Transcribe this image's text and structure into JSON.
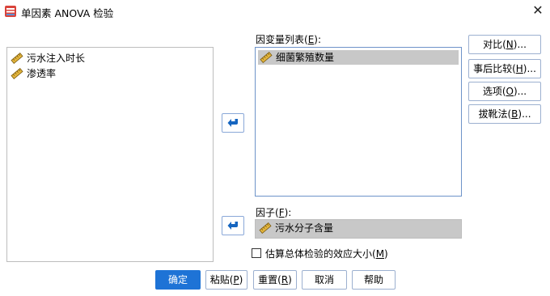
{
  "window": {
    "title": "单因素 ANOVA 检验",
    "close_symbol": "✕"
  },
  "source_list": {
    "items": [
      {
        "label": "污水注入时长",
        "icon": "scale-ruler-icon"
      },
      {
        "label": "渗透率",
        "icon": "scale-ruler-icon"
      }
    ]
  },
  "dependent": {
    "label_prefix": "因变量列表(",
    "label_key": "E",
    "label_suffix": "):",
    "items": [
      {
        "label": "细菌繁殖数量",
        "icon": "scale-ruler-icon",
        "selected": true
      }
    ]
  },
  "factor": {
    "label_prefix": "因子(",
    "label_key": "F",
    "label_suffix": "):",
    "value": "污水分子含量"
  },
  "side_buttons": [
    {
      "pre": "对比(",
      "key": "N",
      "post": ")..."
    },
    {
      "pre": "事后比较(",
      "key": "H",
      "post": ")..."
    },
    {
      "pre": "选项(",
      "key": "O",
      "post": ")..."
    },
    {
      "pre": "拔靴法(",
      "key": "B",
      "post": ")..."
    }
  ],
  "effect_size": {
    "pre": "估算总体检验的效应大小(",
    "key": "M",
    "post": ")",
    "checked": false
  },
  "bottom_buttons": [
    {
      "label": "确定",
      "primary": true
    },
    {
      "pre": "粘贴(",
      "key": "P",
      "post": ")"
    },
    {
      "pre": "重置(",
      "key": "R",
      "post": ")"
    },
    {
      "label": "取消"
    },
    {
      "label": "帮助"
    }
  ],
  "colors": {
    "accent": "#1e73d6",
    "selection": "#c8c8c8",
    "arrow": "#1565c0"
  }
}
